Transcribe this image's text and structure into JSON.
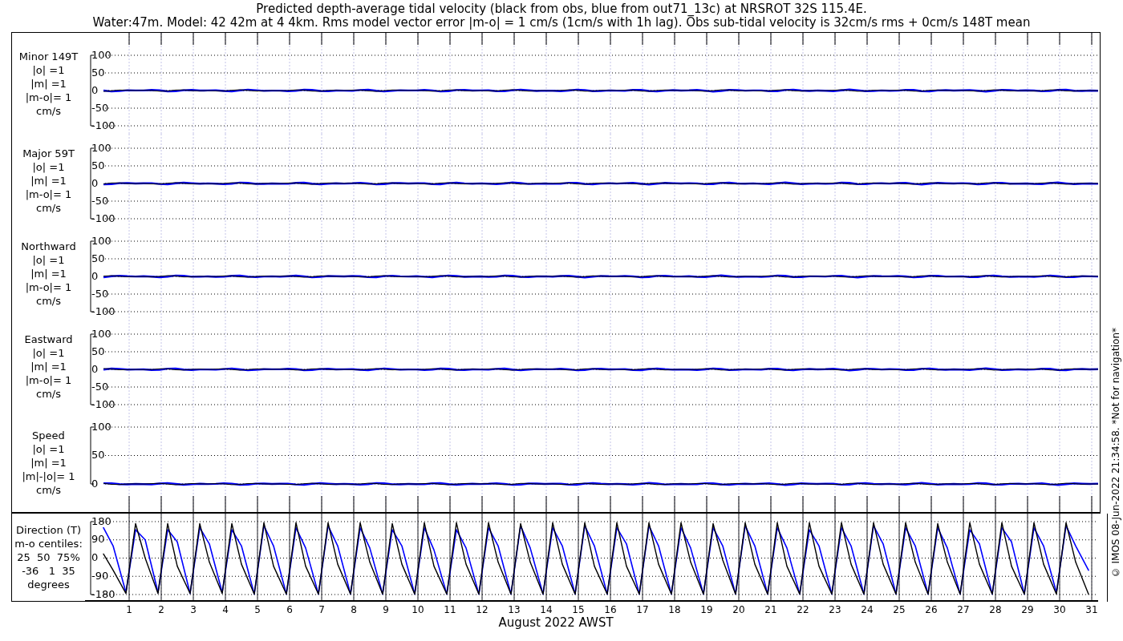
{
  "title": [
    "Predicted depth-average tidal velocity (black from obs, blue from out71_13c) at NRSROT 32S 115.4E.",
    "Water:47m. Model: 42 42m at 4 4km. Rms model vector error |m-o| = 1 cm/s (1cm/s with 1h lag). Obs sub-tidal velocity is 32cm/s rms + 0cm/s 148T mean"
  ],
  "panels": [
    {
      "label": [
        "Minor 149T",
        "|o| =1",
        "|m| =1",
        "|m-o|= 1",
        "cm/s"
      ],
      "y_ticks": [
        "100",
        "50",
        "0",
        "-50",
        "-100"
      ]
    },
    {
      "label": [
        "Major 59T",
        "|o| =1",
        "|m| =1",
        "|m-o|= 1",
        "cm/s"
      ],
      "y_ticks": [
        "100",
        "50",
        "0",
        "-50",
        "-100"
      ]
    },
    {
      "label": [
        "Northward",
        "|o| =1",
        "|m| =1",
        "|m-o|= 1",
        "cm/s"
      ],
      "y_ticks": [
        "100",
        "50",
        "0",
        "-50",
        "-100"
      ]
    },
    {
      "label": [
        "Eastward",
        "|o| =1",
        "|m| =1",
        "|m-o|= 1",
        "cm/s"
      ],
      "y_ticks": [
        "100",
        "50",
        "0",
        "-50",
        "-100"
      ]
    },
    {
      "label": [
        "Speed",
        "|o| =1",
        "|m| =1",
        "|m|-|o|= 1",
        "cm/s"
      ],
      "y_ticks": [
        "100",
        "50",
        "0"
      ]
    }
  ],
  "direction_panel": {
    "label": [
      "Direction (T)",
      "m-o centiles:",
      "25  50  75%",
      "-36   1  35",
      "degrees"
    ],
    "chart_data": {
      "type": "line",
      "grid": true,
      "xlim": [
        0.2,
        31.2
      ],
      "ylim": [
        -180,
        180
      ],
      "yticks": [
        -180,
        -90,
        0,
        90,
        180
      ],
      "xticks": [
        1,
        2,
        3,
        4,
        5,
        6,
        7,
        8,
        9,
        10,
        11,
        12,
        13,
        14,
        15,
        16,
        17,
        18,
        19,
        20,
        21,
        22,
        23,
        24,
        25,
        26,
        27,
        28,
        29,
        30,
        31
      ],
      "x": [
        0.2,
        0.5,
        0.9,
        1.2,
        1.5,
        1.9,
        2.2,
        2.5,
        2.9,
        3.2,
        3.5,
        3.9,
        4.2,
        4.5,
        4.9,
        5.2,
        5.5,
        5.9,
        6.2,
        6.5,
        6.9,
        7.2,
        7.5,
        7.9,
        8.2,
        8.5,
        8.9,
        9.2,
        9.5,
        9.9,
        10.2,
        10.5,
        10.9,
        11.2,
        11.5,
        11.9,
        12.2,
        12.5,
        12.9,
        13.2,
        13.5,
        13.9,
        14.2,
        14.5,
        14.9,
        15.2,
        15.5,
        15.9,
        16.2,
        16.5,
        16.9,
        17.2,
        17.5,
        17.9,
        18.2,
        18.5,
        18.9,
        19.2,
        19.5,
        19.9,
        20.2,
        20.5,
        20.9,
        21.2,
        21.5,
        21.9,
        22.2,
        22.5,
        22.9,
        23.2,
        23.5,
        23.9,
        24.2,
        24.5,
        24.9,
        25.2,
        25.5,
        25.9,
        26.2,
        26.5,
        26.9,
        27.2,
        27.5,
        27.9,
        28.2,
        28.5,
        28.9,
        29.2,
        29.5,
        29.9,
        30.2,
        30.5,
        30.9
      ],
      "series": [
        {
          "color": "#000000",
          "values": [
            20,
            -60,
            -175,
            170,
            0,
            -175,
            170,
            -40,
            -175,
            170,
            -20,
            -175,
            170,
            -30,
            -178,
            175,
            -40,
            -178,
            175,
            -40,
            -178,
            175,
            -30,
            -178,
            175,
            -20,
            -178,
            170,
            -30,
            -178,
            175,
            -40,
            -178,
            175,
            -30,
            -178,
            175,
            -20,
            -178,
            170,
            -20,
            -178,
            175,
            -30,
            -178,
            175,
            -40,
            -178,
            175,
            -40,
            -178,
            175,
            -30,
            -178,
            175,
            -20,
            -178,
            170,
            -10,
            -178,
            175,
            -30,
            -178,
            175,
            -40,
            -178,
            175,
            -40,
            -178,
            175,
            -30,
            -178,
            175,
            -30,
            -178,
            175,
            -20,
            -178,
            170,
            -20,
            -178,
            175,
            -30,
            -178,
            175,
            -40,
            -178,
            175,
            -30,
            -178,
            175,
            -20,
            -178
          ]
        },
        {
          "color": "#0000ff",
          "values": [
            150,
            60,
            -170,
            140,
            90,
            -170,
            140,
            80,
            -175,
            150,
            70,
            -170,
            140,
            60,
            -178,
            160,
            60,
            -178,
            150,
            50,
            -178,
            160,
            60,
            -178,
            150,
            50,
            -178,
            140,
            60,
            -178,
            150,
            40,
            -178,
            140,
            50,
            -178,
            150,
            60,
            -178,
            160,
            50,
            -178,
            150,
            60,
            -178,
            160,
            60,
            -178,
            150,
            70,
            -178,
            160,
            60,
            -178,
            150,
            50,
            -178,
            150,
            60,
            -178,
            160,
            60,
            -178,
            150,
            50,
            -178,
            140,
            60,
            -178,
            150,
            60,
            -178,
            160,
            70,
            -178,
            150,
            60,
            -178,
            150,
            50,
            -178,
            140,
            70,
            -178,
            150,
            80,
            -178,
            150,
            60,
            -170,
            160,
            60,
            -60
          ]
        }
      ]
    }
  },
  "xlabel": "August 2022 AWST",
  "credit": "© IMOS 08-Jun-2022 21:34:58. *Not for navigation*"
}
